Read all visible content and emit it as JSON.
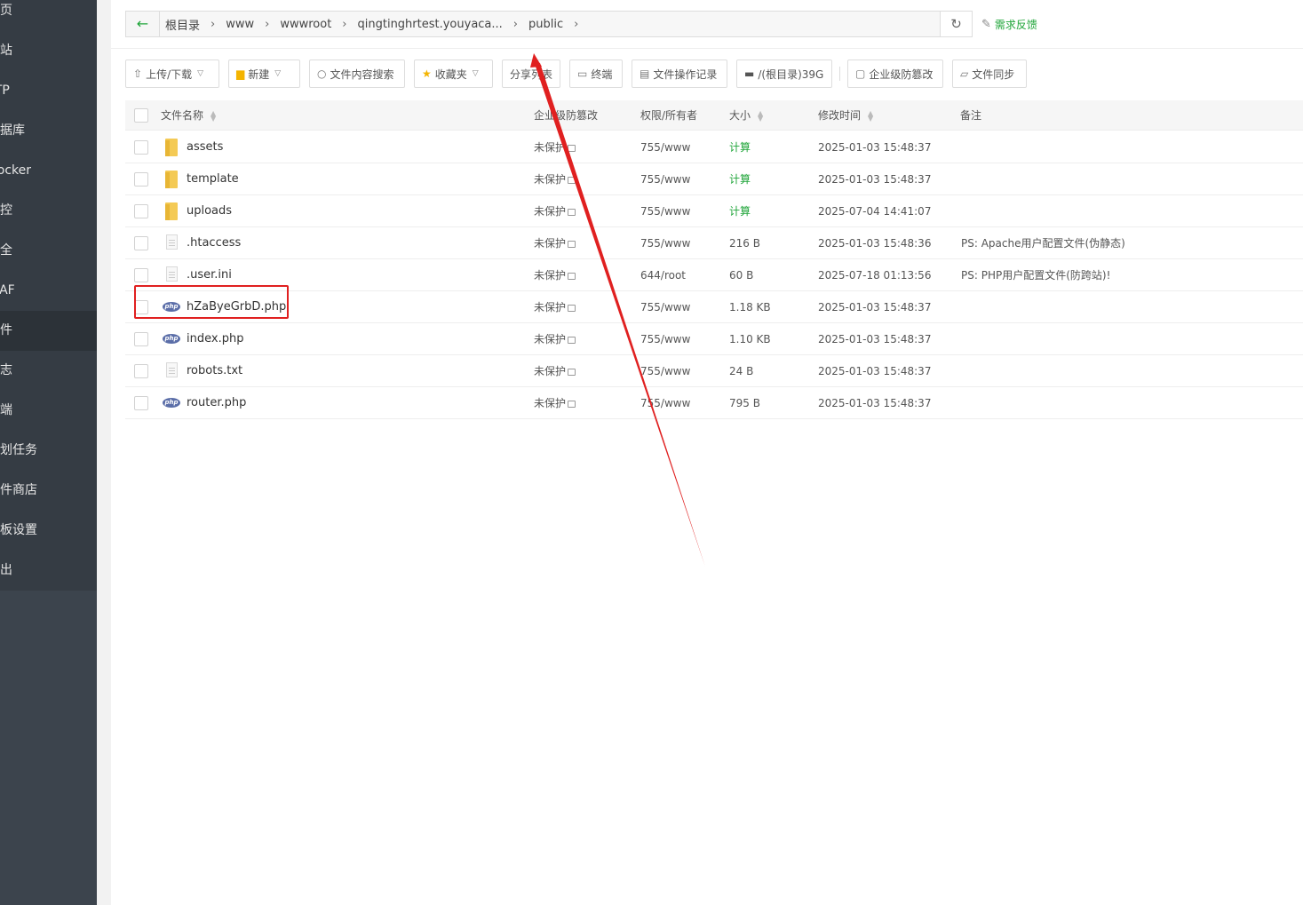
{
  "sidebar": {
    "items": [
      {
        "label": "首页",
        "active": false
      },
      {
        "label": "网站",
        "active": false
      },
      {
        "label": "FTP",
        "active": false
      },
      {
        "label": "数据库",
        "active": false
      },
      {
        "label": "Docker",
        "active": false
      },
      {
        "label": "监控",
        "active": false
      },
      {
        "label": "安全",
        "active": false
      },
      {
        "label": "WAF",
        "active": false
      },
      {
        "label": "文件",
        "active": true
      },
      {
        "label": "日志",
        "active": false
      },
      {
        "label": "终端",
        "active": false
      },
      {
        "label": "计划任务",
        "active": false
      },
      {
        "label": "软件商店",
        "active": false
      },
      {
        "label": "面板设置",
        "active": false
      },
      {
        "label": "退出",
        "active": false
      }
    ]
  },
  "path": {
    "back_icon": "arrow-left-icon",
    "crumbs": [
      "根目录",
      "www",
      "wwwroot",
      "qingtinghrtest.youyaca...",
      "public"
    ],
    "refresh_icon": "refresh-icon",
    "feedback_label": "需求反馈"
  },
  "toolbar": {
    "upload": "上传/下载",
    "new": "新建",
    "search": "文件内容搜索",
    "favorites": "收藏夹",
    "share": "分享列表",
    "terminal": "终端",
    "oplog": "文件操作记录",
    "disk": "/(根目录)39G",
    "tamper": "企业级防篡改",
    "sync": "文件同步"
  },
  "table": {
    "headers": {
      "name": "文件名称",
      "tamper": "企业级防篡改",
      "perm": "权限/所有者",
      "size": "大小",
      "mtime": "修改时间",
      "note": "备注"
    },
    "rows": [
      {
        "type": "folder",
        "name": "assets",
        "tamper": "未保护",
        "perm": "755/www",
        "size": "计算",
        "mtime": "2025-01-03 15:48:37",
        "note": ""
      },
      {
        "type": "folder",
        "name": "template",
        "tamper": "未保护",
        "perm": "755/www",
        "size": "计算",
        "mtime": "2025-01-03 15:48:37",
        "note": ""
      },
      {
        "type": "folder",
        "name": "uploads",
        "tamper": "未保护",
        "perm": "755/www",
        "size": "计算",
        "mtime": "2025-07-04 14:41:07",
        "note": ""
      },
      {
        "type": "file",
        "name": ".htaccess",
        "tamper": "未保护",
        "perm": "755/www",
        "size": "216 B",
        "mtime": "2025-01-03 15:48:36",
        "note": "PS: Apache用户配置文件(伪静态)"
      },
      {
        "type": "file",
        "name": ".user.ini",
        "tamper": "未保护",
        "perm": "644/root",
        "size": "60 B",
        "mtime": "2025-07-18 01:13:56",
        "note": "PS: PHP用户配置文件(防跨站)!"
      },
      {
        "type": "php",
        "name": "hZaByeGrbD.php",
        "tamper": "未保护",
        "perm": "755/www",
        "size": "1.18 KB",
        "mtime": "2025-01-03 15:48:37",
        "note": ""
      },
      {
        "type": "php",
        "name": "index.php",
        "tamper": "未保护",
        "perm": "755/www",
        "size": "1.10 KB",
        "mtime": "2025-01-03 15:48:37",
        "note": ""
      },
      {
        "type": "file",
        "name": "robots.txt",
        "tamper": "未保护",
        "perm": "755/www",
        "size": "24 B",
        "mtime": "2025-01-03 15:48:37",
        "note": ""
      },
      {
        "type": "php",
        "name": "router.php",
        "tamper": "未保护",
        "perm": "755/www",
        "size": "795 B",
        "mtime": "2025-01-03 15:48:37",
        "note": ""
      }
    ]
  },
  "colors": {
    "accent": "#20a53a",
    "annotation": "#e02020",
    "sidebar": "#353c44"
  }
}
